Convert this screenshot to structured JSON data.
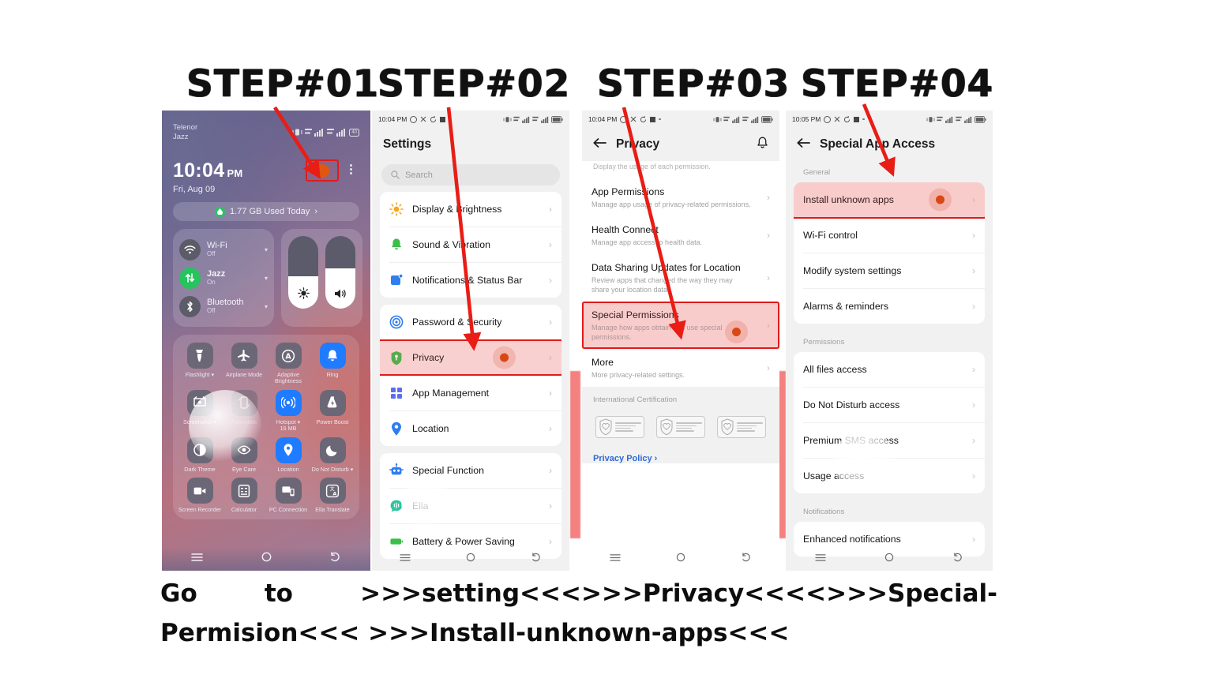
{
  "steps": [
    {
      "label": "STEP#01"
    },
    {
      "label": "STEP#02"
    },
    {
      "label": "STEP#03"
    },
    {
      "label": "STEP#04"
    }
  ],
  "caption": {
    "line1": "Go to >>>setting<<<>>>Privacy<<<<>>>Special-",
    "line2": "Permision<<<  >>>Install-unknown-apps<<<",
    "full": "Go to >>>setting<<<>>>Privacy<<<<>>>Special-Permision<<< >>>Install-unknown-apps<<<",
    "w1": "Go",
    "w2": "to",
    "w3": ">>>setting<<<>>>Privacy<<<<>>>Special-"
  },
  "panel1": {
    "carrier_line1": "Telenor",
    "carrier_line2": "Jazz",
    "clock": "10:04",
    "ampm": "PM",
    "date": "Fri, Aug 09",
    "data_usage": "1.77 GB Used Today",
    "data_usage_caret": "›",
    "battery_label": "40",
    "connections": [
      {
        "name": "Wi-Fi",
        "state": "Off",
        "icon": "wifi-icon",
        "active": false
      },
      {
        "name": "Jazz",
        "state": "On",
        "icon": "mobile-data-icon",
        "active": true
      },
      {
        "name": "Bluetooth",
        "state": "Off",
        "icon": "bluetooth-icon",
        "active": false
      }
    ],
    "brightness_pct": 45,
    "volume_pct": 55,
    "tiles": [
      {
        "label": "Flashlight",
        "icon": "flashlight-icon",
        "on": false,
        "caret": true
      },
      {
        "label": "Airplane Mode",
        "icon": "airplane-icon",
        "on": false,
        "caret": false
      },
      {
        "label": "Adaptive Brightness",
        "icon": "adaptive-brightness-icon",
        "on": false,
        "caret": false
      },
      {
        "label": "Ring",
        "icon": "bell-icon",
        "on": true,
        "caret": false
      },
      {
        "label": "Screenshot",
        "icon": "screenshot-icon",
        "on": false,
        "caret": true
      },
      {
        "label": "Autorotate",
        "icon": "autorotate-icon",
        "on": false,
        "caret": false,
        "dim": true
      },
      {
        "label": "Hotspot",
        "sublabel": "16 MB",
        "icon": "hotspot-icon",
        "on": true,
        "caret": true
      },
      {
        "label": "Power Boost",
        "icon": "power-boost-icon",
        "on": false,
        "caret": false
      },
      {
        "label": "Dark Theme",
        "icon": "dark-theme-icon",
        "on": false,
        "caret": false
      },
      {
        "label": "Eye Care",
        "icon": "eye-care-icon",
        "on": false,
        "caret": false
      },
      {
        "label": "Location",
        "icon": "location-icon",
        "on": true,
        "caret": false
      },
      {
        "label": "Do Not Disturb",
        "icon": "moon-icon",
        "on": false,
        "caret": true
      },
      {
        "label": "Screen Recorder",
        "icon": "screen-recorder-icon",
        "on": false,
        "caret": false
      },
      {
        "label": "Calculator",
        "icon": "calculator-icon",
        "on": false,
        "caret": false
      },
      {
        "label": "PC Connection",
        "icon": "pc-connection-icon",
        "on": false,
        "caret": false
      },
      {
        "label": "Ella Translate",
        "icon": "translate-icon",
        "on": false,
        "caret": false
      }
    ]
  },
  "panel2": {
    "status_time": "10:04 PM",
    "title": "Settings",
    "search_placeholder": "Search",
    "groups": [
      {
        "items": [
          {
            "label": "Display & Brightness",
            "icon": "sun-icon",
            "color": "#f5a623"
          },
          {
            "label": "Sound & Vibration",
            "icon": "bell-icon",
            "color": "#3dbd4a"
          },
          {
            "label": "Notifications & Status Bar",
            "icon": "notification-icon",
            "color": "#2f7ef0"
          }
        ]
      },
      {
        "items": [
          {
            "label": "Password & Security",
            "icon": "security-icon",
            "color": "#2f7ef0"
          },
          {
            "label": "Privacy",
            "icon": "privacy-shield-icon",
            "color": "#3dbd4a",
            "highlighted": true
          },
          {
            "label": "App Management",
            "icon": "apps-grid-icon",
            "color": "#5b6ef0"
          },
          {
            "label": "Location",
            "icon": "location-pin-icon",
            "color": "#2f7ef0"
          }
        ]
      },
      {
        "items": [
          {
            "label": "Special Function",
            "icon": "robot-icon",
            "color": "#2f7ef0"
          },
          {
            "label": "Ella",
            "icon": "ella-icon",
            "color": "#2ec4a0"
          },
          {
            "label": "Battery & Power Saving",
            "icon": "battery-icon",
            "color": "#3dbd4a"
          }
        ]
      }
    ]
  },
  "panel3": {
    "status_time": "10:04 PM",
    "title": "Privacy",
    "top_cut_text": "Display the usage of each permission.",
    "items": [
      {
        "title": "App Permissions",
        "subtitle": "Manage app usage of privacy-related permissions."
      },
      {
        "title": "Health Connect",
        "subtitle": "Manage app access to health data."
      },
      {
        "title": "Data Sharing Updates for Location",
        "subtitle": "Review apps that changed the way they may share your location data."
      },
      {
        "title": "Special Permissions",
        "subtitle": "Manage how apps obtain and use special permissions.",
        "highlighted": true
      },
      {
        "title": "More",
        "subtitle": "More privacy-related settings."
      }
    ],
    "cert_section": "International Certification",
    "policy_link": "Privacy Policy",
    "policy_caret": "›"
  },
  "panel4": {
    "status_time": "10:05 PM",
    "title": "Special App Access",
    "sections": [
      {
        "label": "General",
        "items": [
          {
            "label": "Install unknown apps",
            "highlighted": true
          },
          {
            "label": "Wi-Fi control"
          },
          {
            "label": "Modify system settings"
          },
          {
            "label": "Alarms & reminders"
          }
        ]
      },
      {
        "label": "Permissions",
        "items": [
          {
            "label": "All files access"
          },
          {
            "label": "Do Not Disturb access"
          },
          {
            "label": "Premium SMS access"
          },
          {
            "label": "Usage access"
          }
        ]
      },
      {
        "label": "Notifications",
        "items": [
          {
            "label": "Enhanced notifications"
          }
        ]
      }
    ]
  },
  "navbar": {
    "menu": "menu-icon",
    "home": "home-icon",
    "back": "back-icon"
  },
  "colors": {
    "accent_red": "#e01b1b",
    "highlight_fill": "#f7dede",
    "tap_dot": "#d4480d",
    "link_blue": "#2d6bd8",
    "tile_blue": "#1f7bff",
    "band_salmon": "#f4817f"
  }
}
